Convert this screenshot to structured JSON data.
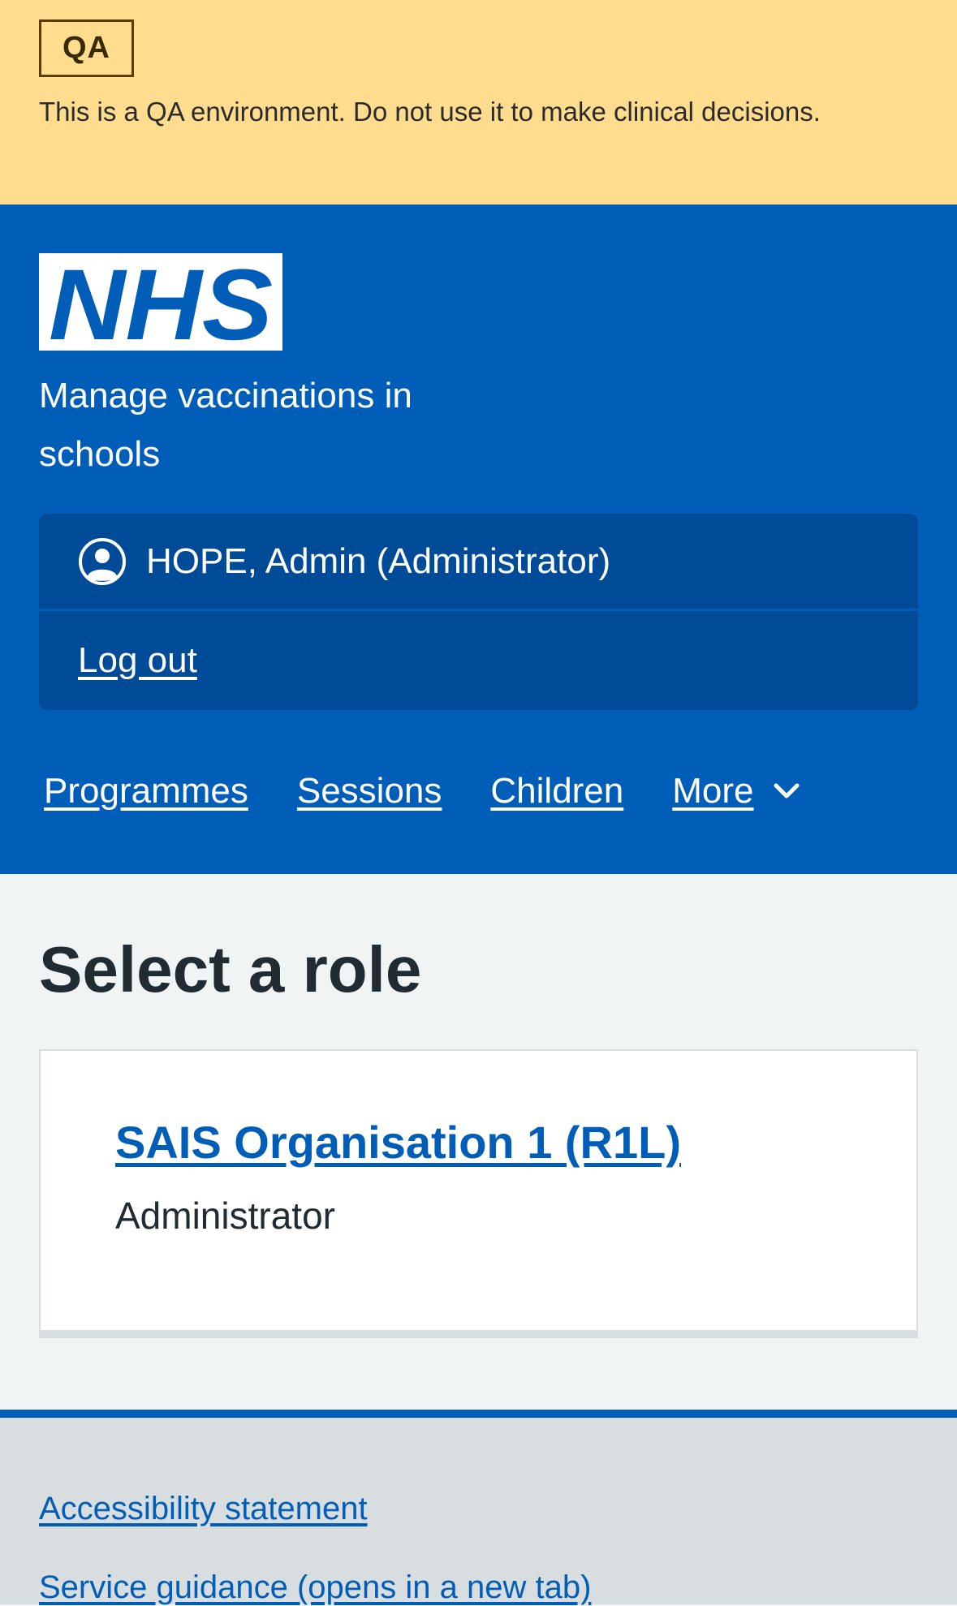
{
  "environment": {
    "tag": "QA",
    "message": "This is a QA environment. Do not use it to make clinical decisions.",
    "banner_color": "#ffdc8e"
  },
  "header": {
    "logo_text": "NHS",
    "service_name": "Manage vaccinations in schools",
    "brand_color": "#005eb8",
    "account": {
      "user_icon": "user-circle-icon",
      "user_label": "HOPE, Admin (Administrator)",
      "logout_label": "Log out"
    },
    "nav": {
      "items": [
        {
          "label": "Programmes"
        },
        {
          "label": "Sessions"
        },
        {
          "label": "Children"
        }
      ],
      "more_label": "More",
      "more_icon": "chevron-down-icon"
    }
  },
  "main": {
    "title": "Select a role",
    "roles": [
      {
        "organisation": "SAIS Organisation 1 (R1L)",
        "role": "Administrator"
      }
    ]
  },
  "footer": {
    "links": [
      {
        "label": "Accessibility statement"
      },
      {
        "label": "Service guidance (opens in a new tab)"
      }
    ]
  }
}
